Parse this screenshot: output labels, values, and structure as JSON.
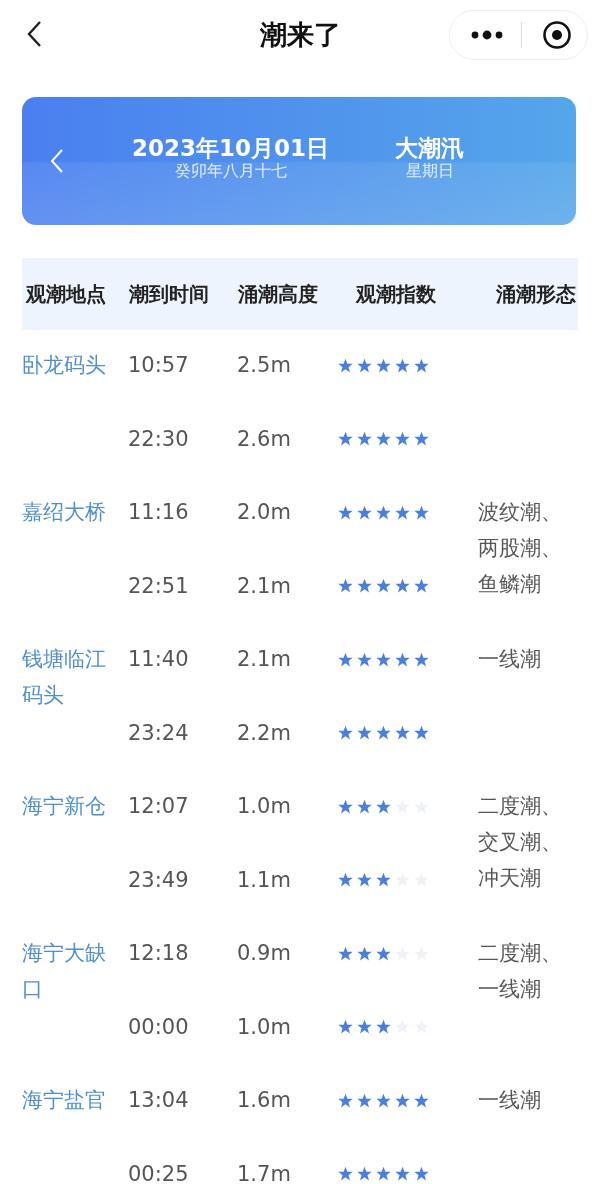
{
  "nav": {
    "title": "潮来了"
  },
  "banner": {
    "date": "2023年10月01日",
    "lunar": "癸卯年八月十七",
    "tide_type": "大潮汛",
    "weekday": "星期日"
  },
  "table": {
    "columns": [
      "观潮地点",
      "潮到时间",
      "涌潮高度",
      "观潮指数",
      "涌潮形态"
    ],
    "rows": [
      {
        "location": "卧龙码头",
        "tides": [
          {
            "time": "10:57",
            "height": "2.5m",
            "stars": 5
          },
          {
            "time": "22:30",
            "height": "2.6m",
            "stars": 5
          }
        ]
      },
      {
        "location": "嘉绍大桥",
        "shape": "波纹潮、两股潮、鱼鳞潮",
        "tides": [
          {
            "time": "11:16",
            "height": "2.0m",
            "stars": 5
          },
          {
            "time": "22:51",
            "height": "2.1m",
            "stars": 5
          }
        ]
      },
      {
        "location": "钱塘临江码头",
        "shape": "一线潮",
        "tides": [
          {
            "time": "11:40",
            "height": "2.1m",
            "stars": 5
          },
          {
            "time": "23:24",
            "height": "2.2m",
            "stars": 5
          }
        ]
      },
      {
        "location": "海宁新仓",
        "shape": "二度潮、交叉潮、冲天潮",
        "tides": [
          {
            "time": "12:07",
            "height": "1.0m",
            "stars": 3
          },
          {
            "time": "23:49",
            "height": "1.1m",
            "stars": 3
          }
        ]
      },
      {
        "location": "海宁大缺口",
        "shape": "二度潮、一线潮",
        "tides": [
          {
            "time": "12:18",
            "height": "0.9m",
            "stars": 3
          },
          {
            "time": "00:00",
            "height": "1.0m",
            "stars": 3
          }
        ]
      },
      {
        "location": "海宁盐官",
        "shape": "一线潮",
        "tides": [
          {
            "time": "13:04",
            "height": "1.6m",
            "stars": 5
          },
          {
            "time": "00:25",
            "height": "1.7m",
            "stars": 5
          }
        ]
      }
    ]
  }
}
